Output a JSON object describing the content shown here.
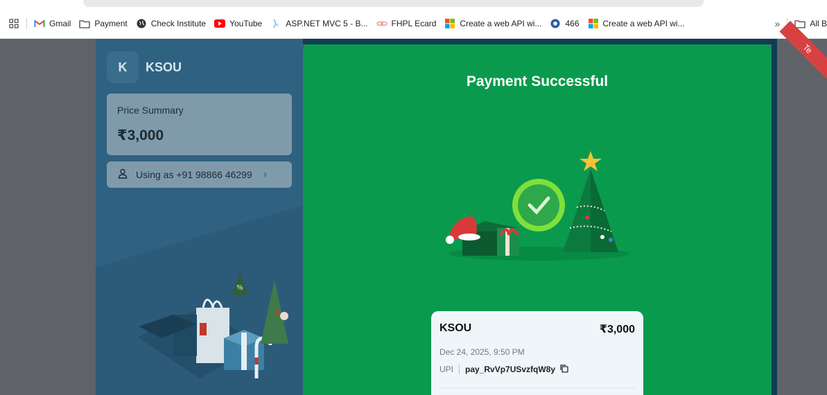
{
  "bookmarks": {
    "items": [
      {
        "label": "Gmail",
        "icon": "gmail-icon"
      },
      {
        "label": "Payment",
        "icon": "folder-icon"
      },
      {
        "label": "Check Institute",
        "icon": "globe-icon"
      },
      {
        "label": "YouTube",
        "icon": "youtube-icon"
      },
      {
        "label": "ASP.NET MVC 5 - B...",
        "icon": "aspnet-icon"
      },
      {
        "label": "FHPL Ecard",
        "icon": "link-icon"
      },
      {
        "label": "Create a web API wi...",
        "icon": "microsoft-icon"
      },
      {
        "label": "466",
        "icon": "site-icon"
      },
      {
        "label": "Create a web API wi...",
        "icon": "microsoft-icon"
      }
    ],
    "overflow_label": "»",
    "all_bookmarks_label": "All B"
  },
  "merchant": {
    "initial": "K",
    "name": "KSOU"
  },
  "price_summary": {
    "title": "Price Summary",
    "amount": "₹3,000"
  },
  "user": {
    "using_as": "Using as +91 98866 46299"
  },
  "status": {
    "title": "Payment Successful"
  },
  "receipt": {
    "merchant": "KSOU",
    "amount": "₹3,000",
    "datetime": "Dec 24, 2025, 9:50 PM",
    "method": "UPI",
    "payment_id": "pay_RvVp7USvzfqW8y"
  },
  "ribbon": {
    "label": "Te"
  },
  "colors": {
    "success_green": "#0a9a4d",
    "panel_blue": "#2f6180",
    "card_gray": "#7f9bab"
  }
}
